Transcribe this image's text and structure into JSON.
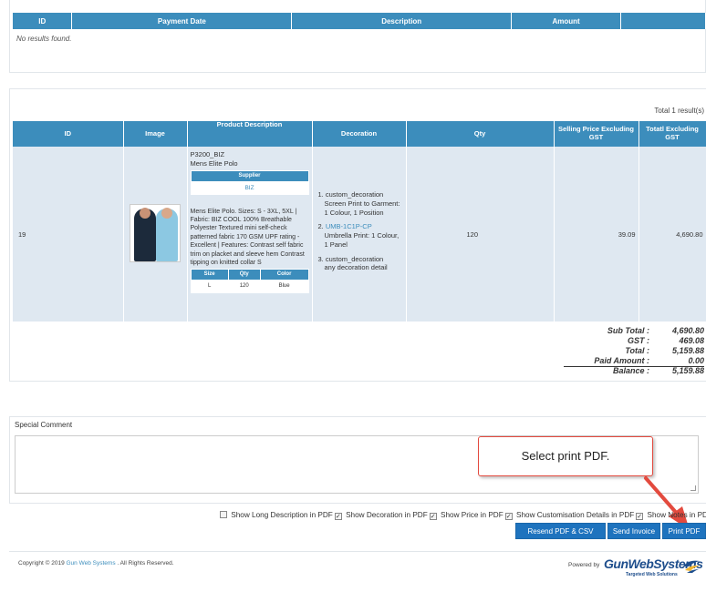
{
  "payments": {
    "headers": [
      "ID",
      "Payment Date",
      "Description",
      "Amount",
      ""
    ],
    "empty_text": "No results found."
  },
  "products": {
    "total_results": "Total 1 result(s)",
    "headers": [
      "ID",
      "Image",
      "Product Description",
      "Decoration",
      "Qty",
      "Selling Price Excluding GST",
      "Totatl Excluding GST"
    ],
    "row": {
      "id": "19",
      "code": "P3200_BIZ",
      "name": "Mens Elite Polo",
      "supplier_header": "Supplier",
      "supplier": "BIZ",
      "long_description": "Mens Elite Polo. Sizes: S - 3XL, 5XL | Fabric: BIZ COOL 100% Breathable Polyester Textured mini self-check patterned fabric 170 GSM UPF rating - Excellent | Features: Contrast self fabric trim on placket and sleeve hem Contrast tipping on knitted collar S",
      "size_headers": [
        "Size",
        "Qty",
        "Color"
      ],
      "size_row": [
        "L",
        "120",
        "Blue"
      ],
      "decorations": [
        {
          "num": "1.",
          "name": "custom_decoration",
          "detail": "Screen Print to Garment: 1 Colour, 1 Position",
          "link": false
        },
        {
          "num": "2.",
          "name": "UMB-1C1P-CP",
          "detail": "Umbrella Print: 1 Colour, 1 Panel",
          "link": true
        },
        {
          "num": "3.",
          "name": "custom_decoration",
          "detail": "any decoration detail",
          "link": false
        }
      ],
      "qty": "120",
      "selling_price": "39.09",
      "total": "4,690.80"
    },
    "totals": [
      {
        "label": "Sub Total :",
        "value": "4,690.80"
      },
      {
        "label": "GST :",
        "value": "469.08"
      },
      {
        "label": "Total :",
        "value": "5,159.88"
      },
      {
        "label": "Paid Amount :",
        "value": "0.00"
      },
      {
        "label": "Balance :",
        "value": "5,159.88"
      }
    ]
  },
  "comment": {
    "label": "Special Comment",
    "value": ""
  },
  "callout": "Select print PDF.",
  "pdf_options": {
    "long_description": "Show Long Description in PDF",
    "decoration": "Show Decoration in PDF",
    "price": "Show Price in PDF",
    "customisation": "Show Customisation Details in PDF",
    "notes": "Show Notes in PDF"
  },
  "buttons": {
    "resend": "Resend PDF & CSV",
    "send_invoice": "Send Invoice",
    "print_pdf": "Print PDF"
  },
  "footer": {
    "copyright_prefix": "Copyright © 2019",
    "company": "Gun Web Systems",
    "copyright_suffix": ". All Rights Reserved.",
    "powered_by": "Powered by",
    "brand": "GunWebSystems",
    "brand_tagline": "Targeted Web Solutions"
  },
  "colors": {
    "header_blue": "#3c8dbc",
    "row_bg": "#dfe8f1",
    "button_blue": "#1e73be",
    "callout_red": "#e34a3e"
  }
}
